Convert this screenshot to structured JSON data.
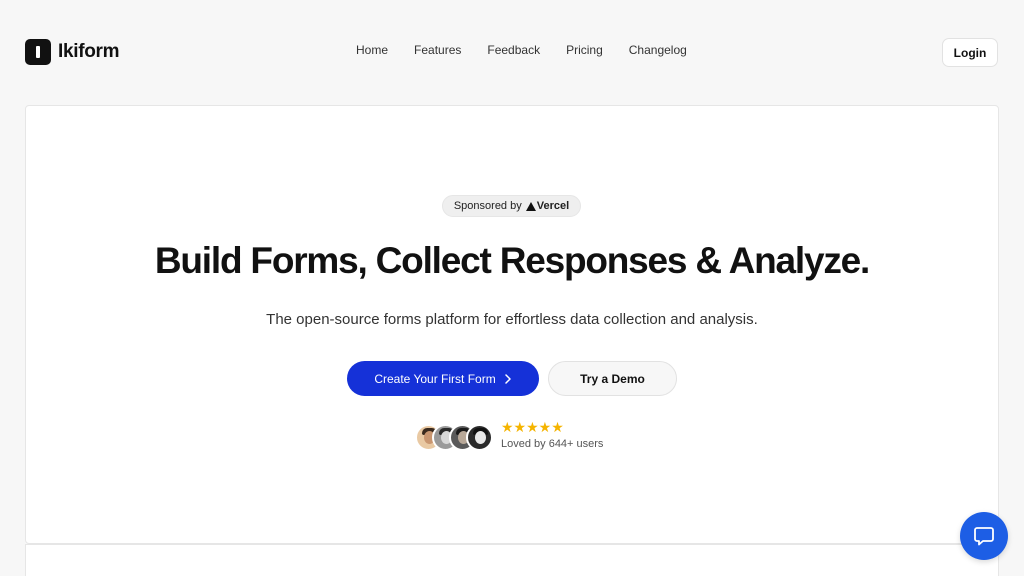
{
  "brand": {
    "name": "Ikiform"
  },
  "nav": {
    "items": [
      "Home",
      "Features",
      "Feedback",
      "Pricing",
      "Changelog"
    ]
  },
  "header": {
    "login_label": "Login"
  },
  "hero": {
    "sponsor_prefix": "Sponsored by",
    "sponsor_name": "Vercel",
    "headline": "Build Forms, Collect Responses & Analyze.",
    "subtitle": "The open-source forms platform for effortless data collection and analysis.",
    "primary_cta": "Create Your First Form",
    "secondary_cta": "Try a Demo",
    "rating_stars": "★★★★★",
    "social_proof": "Loved by 644+ users"
  },
  "colors": {
    "primary": "#1531d8",
    "chat_bubble": "#1d5ee5",
    "star": "#f5b400"
  },
  "icons": {
    "logo": "ikiform-logo-icon",
    "cta_arrow": "chevron-right-icon",
    "chat": "chat-bubble-icon"
  }
}
